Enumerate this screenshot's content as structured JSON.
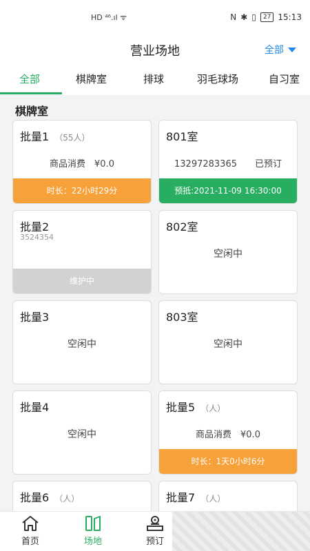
{
  "status": {
    "left": "HD ⁴⁶.ıl ᯤ",
    "battery": "27",
    "time": "15:13"
  },
  "header": {
    "title": "营业场地",
    "filter_label": "全部"
  },
  "tabs": [
    {
      "label": "全部"
    },
    {
      "label": "棋牌室"
    },
    {
      "label": "排球"
    },
    {
      "label": "羽毛球场"
    },
    {
      "label": "自习室"
    }
  ],
  "section": {
    "title": "棋牌室"
  },
  "cards": [
    {
      "name": "批量1",
      "cap": "（55人）",
      "line": "商品消费　¥0.0",
      "foot": "时长：22小时29分"
    },
    {
      "name": "801室",
      "line": "13297283365　　已预订",
      "foot": "预抵:2021-11-09 16:30:00"
    },
    {
      "name": "批量2",
      "sub": "3524354",
      "foot": "维护中"
    },
    {
      "name": "802室",
      "idle": "空闲中"
    },
    {
      "name": "批量3",
      "idle": "空闲中"
    },
    {
      "name": "803室",
      "idle": "空闲中"
    },
    {
      "name": "批量4",
      "idle": "空闲中"
    },
    {
      "name": "批量5",
      "cap": "（人）",
      "line": "商品消费　¥0.0",
      "foot": "时长：1天0小时6分"
    },
    {
      "name": "批量6",
      "cap": "（人）"
    },
    {
      "name": "批量7",
      "cap": "（人）"
    }
  ],
  "nav": [
    {
      "label": "首页"
    },
    {
      "label": "场地"
    },
    {
      "label": "预订"
    }
  ],
  "colors": {
    "accent": "#27ae60",
    "link": "#1e88e5",
    "orange": "#f7a13a",
    "gray": "#d2d2d2"
  }
}
